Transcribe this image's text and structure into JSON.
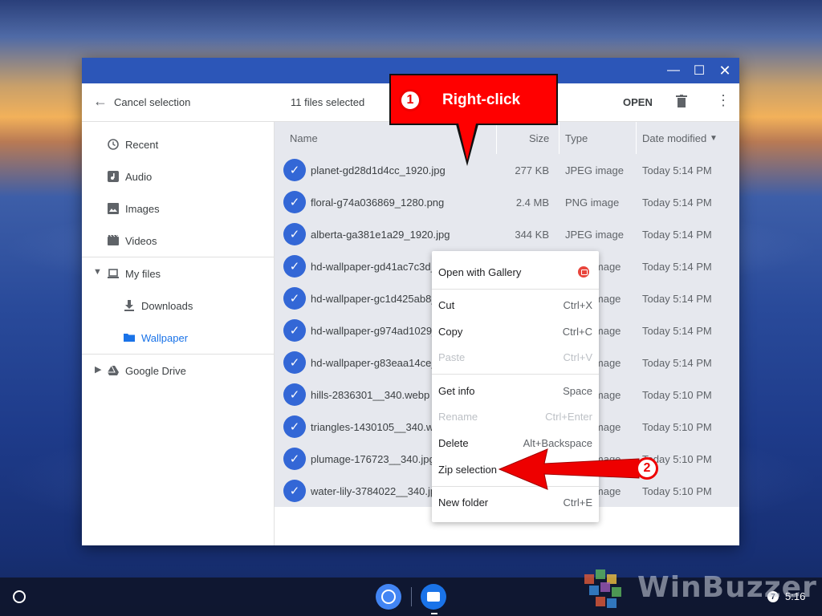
{
  "window": {
    "controls": {
      "minimize": "—",
      "maximize": "☐",
      "close": "✕"
    }
  },
  "toolbar": {
    "cancel_label": "Cancel selection",
    "selected_count": "11 files selected",
    "open_label": "OPEN"
  },
  "sidebar": {
    "items": [
      {
        "label": "Recent",
        "icon": "clock-icon"
      },
      {
        "label": "Audio",
        "icon": "audio-icon"
      },
      {
        "label": "Images",
        "icon": "image-icon"
      },
      {
        "label": "Videos",
        "icon": "video-icon"
      },
      {
        "label": "My files",
        "icon": "laptop-icon"
      },
      {
        "label": "Downloads",
        "icon": "download-icon"
      },
      {
        "label": "Wallpaper",
        "icon": "folder-icon"
      },
      {
        "label": "Google Drive",
        "icon": "drive-icon"
      }
    ]
  },
  "filelist": {
    "headers": {
      "name": "Name",
      "size": "Size",
      "type": "Type",
      "date": "Date modified"
    },
    "rows": [
      {
        "name": "planet-gd28d1d4cc_1920.jpg",
        "size": "277 KB",
        "type": "JPEG image",
        "date": "Today 5:14 PM"
      },
      {
        "name": "floral-g74a036869_1280.png",
        "size": "2.4 MB",
        "type": "PNG image",
        "date": "Today 5:14 PM"
      },
      {
        "name": "alberta-ga381e1a29_1920.jpg",
        "size": "344 KB",
        "type": "JPEG image",
        "date": "Today 5:14 PM"
      },
      {
        "name": "hd-wallpaper-gd41ac7c3d_",
        "size": "",
        "type": "image",
        "date": "Today 5:14 PM"
      },
      {
        "name": "hd-wallpaper-gc1d425ab8_",
        "size": "",
        "type": "image",
        "date": "Today 5:14 PM"
      },
      {
        "name": "hd-wallpaper-g974ad1029_",
        "size": "",
        "type": "image",
        "date": "Today 5:14 PM"
      },
      {
        "name": "hd-wallpaper-g83eaa14ce_",
        "size": "",
        "type": "image",
        "date": "Today 5:14 PM"
      },
      {
        "name": "hills-2836301__340.webp",
        "size": "",
        "type": "image",
        "date": "Today 5:10 PM"
      },
      {
        "name": "triangles-1430105__340.we",
        "size": "",
        "type": "image",
        "date": "Today 5:10 PM"
      },
      {
        "name": "plumage-176723__340.jpg",
        "size": "",
        "type": "image",
        "date": "Today 5:10 PM"
      },
      {
        "name": "water-lily-3784022__340.jp",
        "size": "",
        "type": "image",
        "date": "Today 5:10 PM"
      }
    ]
  },
  "context_menu": {
    "items": [
      {
        "label": "Open with Gallery",
        "shortcut": "",
        "disabled": false
      },
      {
        "label": "Cut",
        "shortcut": "Ctrl+X",
        "disabled": false
      },
      {
        "label": "Copy",
        "shortcut": "Ctrl+C",
        "disabled": false
      },
      {
        "label": "Paste",
        "shortcut": "Ctrl+V",
        "disabled": true
      },
      {
        "label": "Get info",
        "shortcut": "Space",
        "disabled": false
      },
      {
        "label": "Rename",
        "shortcut": "Ctrl+Enter",
        "disabled": true
      },
      {
        "label": "Delete",
        "shortcut": "Alt+Backspace",
        "disabled": false
      },
      {
        "label": "Zip selection",
        "shortcut": "",
        "disabled": false
      },
      {
        "label": "New folder",
        "shortcut": "Ctrl+E",
        "disabled": false
      }
    ]
  },
  "annotations": {
    "step1_number": "1",
    "step1_label": "Right-click",
    "step2_number": "2",
    "color": "#ff0000"
  },
  "taskbar": {
    "notification_count": "7",
    "time": "5:16"
  },
  "watermark": {
    "text": "WinBuzzer"
  }
}
